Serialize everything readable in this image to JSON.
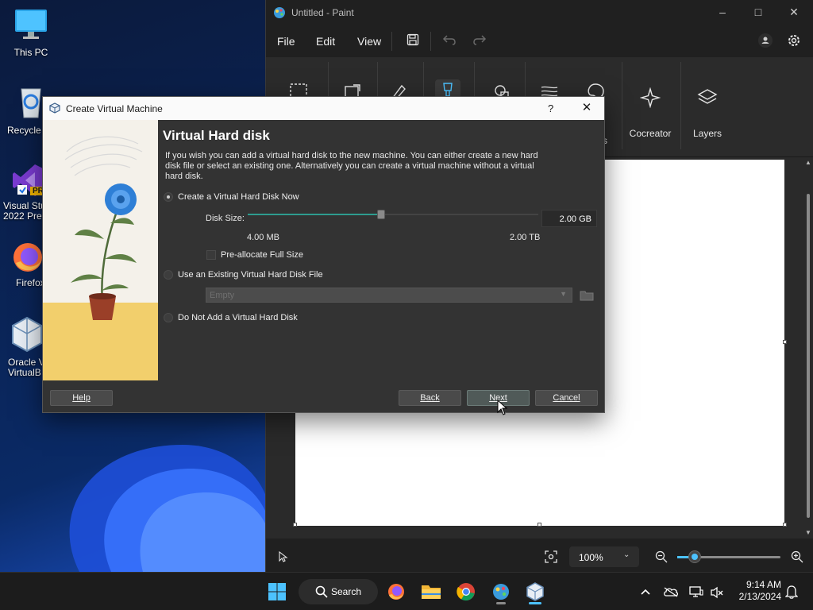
{
  "desktop": {
    "icons": [
      {
        "label": "This PC"
      },
      {
        "label": "Recycle"
      },
      {
        "label": "Visual Stu",
        "label2": "2022 Prev",
        "badge": "PR"
      },
      {
        "label": "Firefox"
      },
      {
        "label": "Oracle V",
        "label2": "VirtualB"
      }
    ]
  },
  "paint": {
    "title": "Untitled - Paint",
    "menu": {
      "file": "File",
      "edit": "Edit",
      "view": "View"
    },
    "ribbon": {
      "cocreator": "Cocreator",
      "layers": "Layers",
      "partial_label": "s"
    },
    "zoom": "100%"
  },
  "dialog": {
    "title": "Create Virtual Machine",
    "help_glyph": "?",
    "heading": "Virtual Hard disk",
    "description": "If you wish you can add a virtual hard disk to the new machine. You can either create a new hard disk file or select an existing one. Alternatively you can create a virtual machine without a virtual hard disk.",
    "options": {
      "create_now": "Create a Virtual Hard Disk Now",
      "use_existing": "Use an Existing Virtual Hard Disk File",
      "do_not_add": "Do Not Add a Virtual Hard Disk"
    },
    "selected_option": "create_now",
    "disk_size_label": "Disk Size:",
    "disk_size_value": "2.00 GB",
    "disk_size_fraction": 0.46,
    "min_label": "4.00 MB",
    "max_label": "2.00 TB",
    "preallocate_label": "Pre-allocate Full Size",
    "preallocate_checked": false,
    "existing_combo_value": "Empty",
    "buttons": {
      "help": "Help",
      "back": "Back",
      "next": "Next",
      "cancel": "Cancel"
    }
  },
  "taskbar": {
    "search_label": "Search",
    "time": "9:14 AM",
    "date": "2/13/2024"
  },
  "colors": {
    "accent": "#4cc2ff",
    "slider_fill": "#2e9c8f",
    "dialog_bg": "#333333",
    "paint_bg": "#202020"
  }
}
